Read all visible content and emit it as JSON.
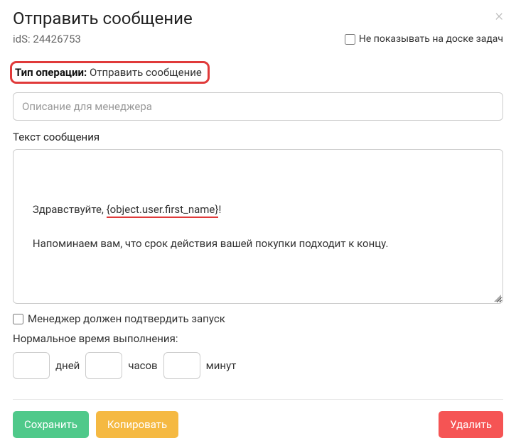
{
  "header": {
    "title": "Отправить сообщение",
    "ids_text": "idS: 24426753",
    "hide_on_board_label": "Не показывать на доске задач"
  },
  "operation": {
    "type_label": "Тип операции",
    "type_value": "Отправить сообщение",
    "desc_placeholder": "Описание для менеджера"
  },
  "message": {
    "section_label": "Текст сообщения",
    "line1_prefix": "Здравствуйте, ",
    "line1_placeholder": "{object.user.first_name}",
    "line1_suffix": "!",
    "line2": "Напоминаем вам, что срок действия вашей покупки подходит к концу."
  },
  "options": {
    "manager_confirm_label": "Менеджер должен подтвердить запуск",
    "normal_time_label": "Нормальное время выполнения:",
    "days_unit": "дней",
    "hours_unit": "часов",
    "minutes_unit": "минут"
  },
  "footer": {
    "save_label": "Сохранить",
    "copy_label": "Копировать",
    "delete_label": "Удалить"
  }
}
